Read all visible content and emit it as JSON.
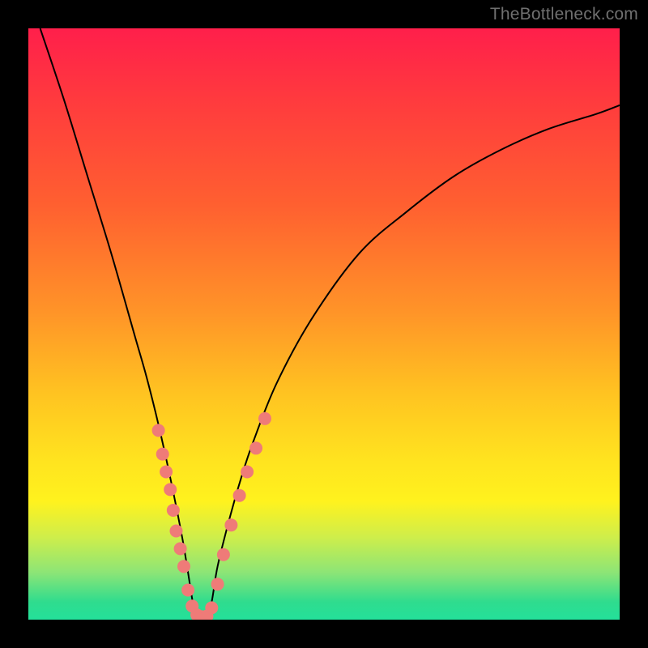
{
  "watermark": "TheBottleneck.com",
  "colors": {
    "curve": "#000000",
    "marker_fill": "#ef7b78",
    "marker_stroke": "#e06c69",
    "bg_black": "#000000"
  },
  "chart_data": {
    "type": "line",
    "title": "",
    "xlabel": "",
    "ylabel": "",
    "xlim": [
      0,
      100
    ],
    "ylim": [
      0,
      100
    ],
    "grid": false,
    "legend": false,
    "note": "V-shaped bottleneck curve; minimum near x≈29, y≈0. Background encodes value: red=high (≈100%) at top, green=low (≈0%) at bottom. No axes/ticks/labels rendered.",
    "series": [
      {
        "name": "bottleneck-curve",
        "x": [
          2,
          6,
          10,
          14,
          18,
          20,
          22,
          24,
          26,
          27,
          28,
          29,
          30,
          31,
          32,
          34,
          36,
          38,
          42,
          48,
          56,
          64,
          72,
          80,
          88,
          96,
          100
        ],
        "y": [
          100,
          88,
          75,
          62,
          48,
          41,
          33,
          24,
          14,
          8,
          2,
          0,
          0,
          3,
          9,
          17,
          24,
          30,
          40,
          51,
          62,
          69,
          75,
          79.5,
          83,
          85.5,
          87
        ]
      }
    ],
    "markers": {
      "name": "highlighted-points",
      "note": "salmon dots clustered along lower V arms",
      "points": [
        {
          "x": 22.0,
          "y": 32
        },
        {
          "x": 22.7,
          "y": 28
        },
        {
          "x": 23.3,
          "y": 25
        },
        {
          "x": 24.0,
          "y": 22
        },
        {
          "x": 24.5,
          "y": 18.5
        },
        {
          "x": 25.0,
          "y": 15
        },
        {
          "x": 25.7,
          "y": 12
        },
        {
          "x": 26.3,
          "y": 9
        },
        {
          "x": 27.0,
          "y": 5
        },
        {
          "x": 27.7,
          "y": 2.3
        },
        {
          "x": 28.5,
          "y": 0.8
        },
        {
          "x": 29.3,
          "y": 0.5
        },
        {
          "x": 30.2,
          "y": 0.6
        },
        {
          "x": 31.0,
          "y": 2
        },
        {
          "x": 32.0,
          "y": 6
        },
        {
          "x": 33.0,
          "y": 11
        },
        {
          "x": 34.3,
          "y": 16
        },
        {
          "x": 35.7,
          "y": 21
        },
        {
          "x": 37.0,
          "y": 25
        },
        {
          "x": 38.5,
          "y": 29
        },
        {
          "x": 40.0,
          "y": 34
        }
      ]
    }
  }
}
